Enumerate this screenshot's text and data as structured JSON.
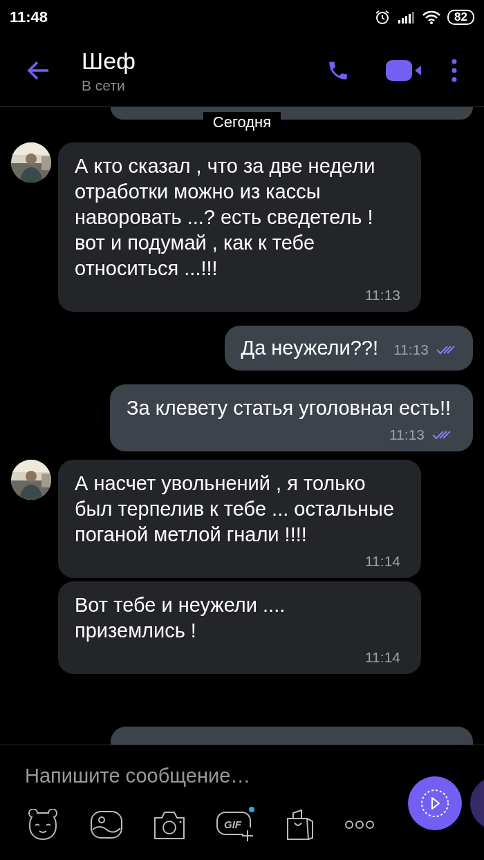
{
  "status_bar": {
    "time": "11:48",
    "battery": "82"
  },
  "header": {
    "title": "Шеф",
    "subtitle": "В сети"
  },
  "date_chip": "Сегодня",
  "messages": [
    {
      "kind": "incoming",
      "avatar": true,
      "text": "А кто сказал , что за две недели отработки можно из кассы наворовать ...? есть сведетель ! вот и подумай , как к тебе относиться ...!!!",
      "time": "11:13"
    },
    {
      "kind": "outgoing",
      "text": "Да неужели??!",
      "time": "11:13",
      "read": true
    },
    {
      "kind": "outgoing",
      "text": "За клевету статья уголовная есть!!",
      "time": "11:13",
      "read": true
    },
    {
      "kind": "incoming",
      "avatar": true,
      "text": "А насчет увольнений , я только был терпелив к тебе ... остальные поганой метлой гнали !!!!",
      "time": "11:14"
    },
    {
      "kind": "incoming",
      "avatar": false,
      "text": "Вот тебе и неужели .... приземлись !",
      "time": "11:14"
    }
  ],
  "composer": {
    "placeholder": "Напишите сообщение…",
    "gif_label": "GIF",
    "gif_new": true
  }
}
